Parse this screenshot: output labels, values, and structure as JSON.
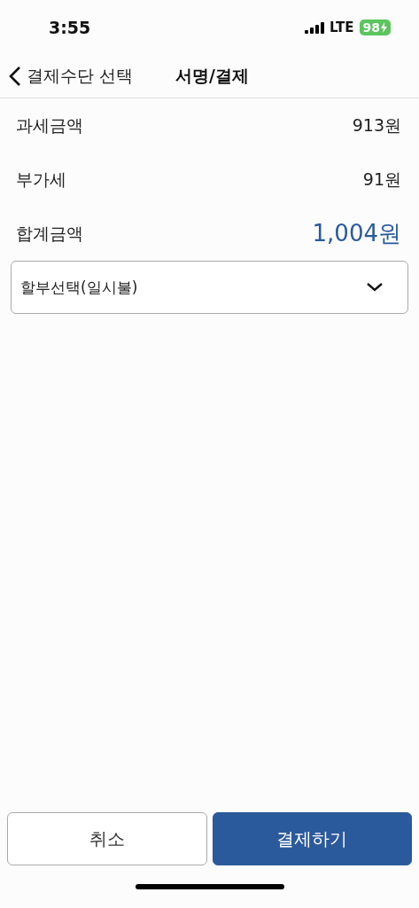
{
  "status_bar": {
    "time": "3:55",
    "network": "LTE",
    "battery": "98"
  },
  "nav": {
    "back_label": "결제수단 선택",
    "title": "서명/결제"
  },
  "rows": [
    {
      "label": "과세금액",
      "value": "913원",
      "kind": "plain"
    },
    {
      "label": "부가세",
      "value": "91원",
      "kind": "plain"
    },
    {
      "label": "합계금액",
      "value": "1,004원",
      "kind": "total"
    }
  ],
  "installment_select": {
    "value": "할부선택(일시불)"
  },
  "buttons": [
    {
      "label": "취소",
      "kind": "secondary"
    },
    {
      "label": "결제하기",
      "kind": "primary"
    }
  ]
}
